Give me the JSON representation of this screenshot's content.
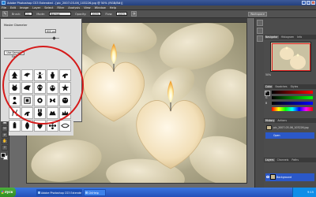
{
  "window": {
    "title": "Adobe Photoshop CS3 Extended - [pic_2007-03-06_103226.jpg @ 50% (RGB/8#)]",
    "controls": [
      "_",
      "□",
      "×"
    ]
  },
  "menu": [
    "File",
    "Edit",
    "Image",
    "Layer",
    "Select",
    "Filter",
    "Analysis",
    "View",
    "Window",
    "Help"
  ],
  "options_bar": {
    "brush_label": "Brush:",
    "brush_size": "21",
    "mode_label": "Mode:",
    "mode_value": "Normal",
    "opacity_label": "Opacity:",
    "opacity_value": "100%",
    "flow_label": "Flow:",
    "flow_value": "100%",
    "workspace": "Workspace"
  },
  "brush_picker": {
    "diameter_label": "Master Diameter",
    "diameter_value": "600 px",
    "use_sample_label": "Use Sample Size",
    "brush_icons": [
      "tree-brush-icon",
      "bird-brush-icon",
      "fairy-brush-icon",
      "angel-brush-icon",
      "pony-brush-icon",
      "cat-brush-icon",
      "dragon-brush-icon",
      "skull-brush-icon",
      "owl-brush-icon",
      "star-brush-icon",
      "girl-brush-icon",
      "frame-brush-icon",
      "rose-brush-icon",
      "butterfly-brush-icon",
      "face-brush-icon",
      "deer-brush-icon",
      "horse-brush-icon",
      "bunny-brush-icon",
      "wolf-brush-icon",
      "crown-brush-icon",
      "lantern-brush-icon",
      "leaf-brush-icon",
      "heart-brush-icon",
      "flower-brush-icon",
      "ornament-brush-icon"
    ]
  },
  "panels": {
    "navigator_tabs": [
      "Navigator",
      "Histogram",
      "Info"
    ],
    "zoom": "50%",
    "color_tabs": [
      "Color",
      "Swatches",
      "Styles"
    ],
    "color_channels": [
      "R",
      "G",
      "B"
    ],
    "history_tabs": [
      "History",
      "Actions"
    ],
    "history_items": [
      "pic_2007-03-06_103226.jpg",
      "Open"
    ],
    "layers_tabs": [
      "Layers",
      "Channels",
      "Paths"
    ],
    "layer_name": "Background"
  },
  "taskbar": {
    "start": "пуск",
    "tasks": [
      "Adobe Photoshop CS3 Extended",
      "ChiHelp"
    ],
    "clock": "9:15"
  }
}
